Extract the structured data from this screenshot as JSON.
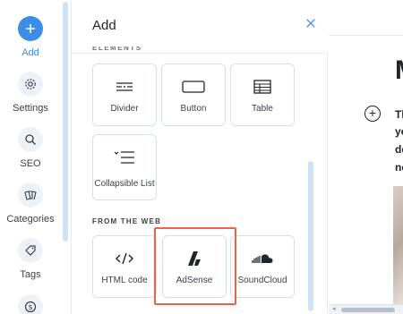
{
  "rail": {
    "items": [
      {
        "label": "Add",
        "icon": "plus-icon",
        "active": true
      },
      {
        "label": "Settings",
        "icon": "gear-icon"
      },
      {
        "label": "SEO",
        "icon": "search-icon"
      },
      {
        "label": "Categories",
        "icon": "categories-icon"
      },
      {
        "label": "Tags",
        "icon": "tag-icon"
      },
      {
        "label": "",
        "icon": "dollar-icon"
      }
    ]
  },
  "panel": {
    "title": "Add",
    "close_icon": "close-icon",
    "section_cut_label": "ELEMENTS",
    "elements": [
      {
        "label": "Divider",
        "icon": "divider-icon"
      },
      {
        "label": "Button",
        "icon": "button-icon"
      },
      {
        "label": "Table",
        "icon": "table-icon"
      },
      {
        "label": "Collapsible List",
        "icon": "collapsible-list-icon"
      }
    ],
    "web_section_title": "FROM THE WEB",
    "web": [
      {
        "label": "HTML code",
        "icon": "code-icon"
      },
      {
        "label": "AdSense",
        "icon": "adsense-icon",
        "highlighted": true
      },
      {
        "label": "SoundCloud",
        "icon": "soundcloud-icon"
      }
    ]
  },
  "preview": {
    "title_char": "M",
    "lines": [
      "Th",
      "yo",
      "de",
      "ne"
    ]
  },
  "colors": {
    "accent": "#3b8dea",
    "highlight": "#e8644a"
  }
}
